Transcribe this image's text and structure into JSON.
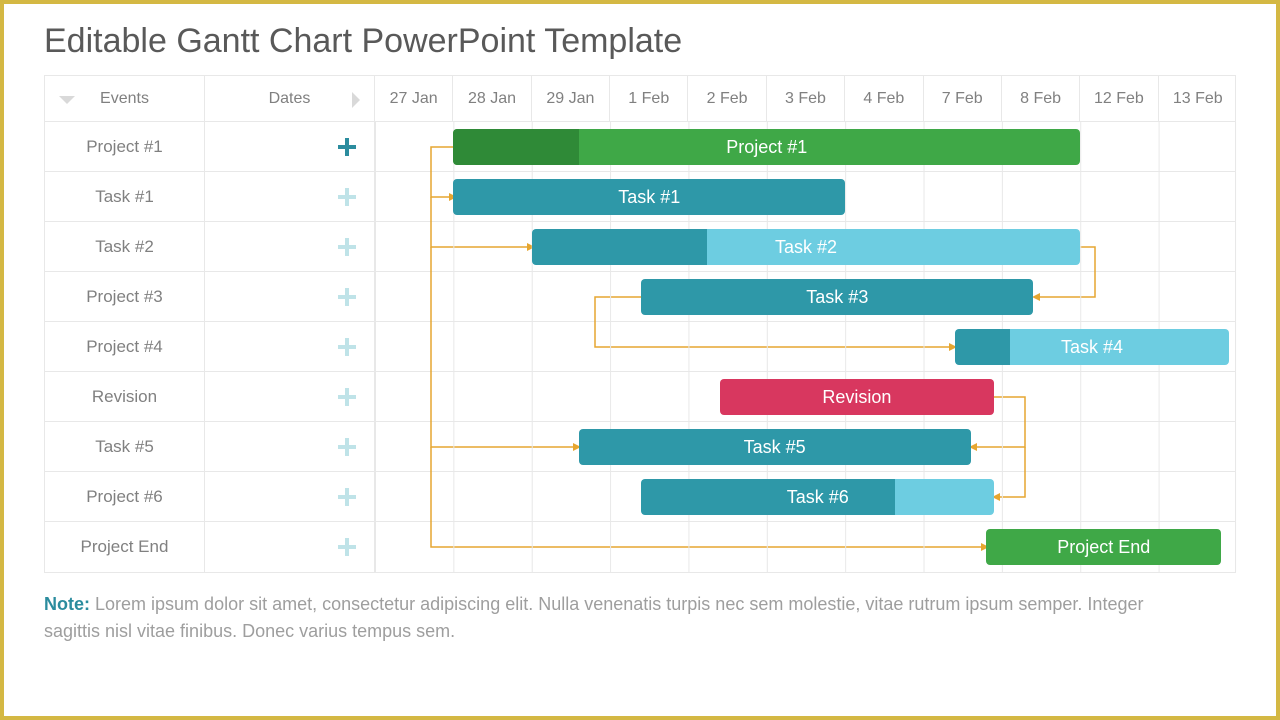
{
  "title": "Editable Gantt Chart PowerPoint Template",
  "headers": {
    "events": "Events",
    "dates": "Dates",
    "timeline": [
      "27 Jan",
      "28 Jan",
      "29 Jan",
      "1 Feb",
      "2 Feb",
      "3 Feb",
      "4 Feb",
      "7 Feb",
      "8 Feb",
      "12 Feb",
      "13 Feb"
    ]
  },
  "rows": [
    {
      "label": "Project #1",
      "plus": "dark"
    },
    {
      "label": "Task #1",
      "plus": "light"
    },
    {
      "label": "Task #2",
      "plus": "light"
    },
    {
      "label": "Project #3",
      "plus": "light"
    },
    {
      "label": "Project #4",
      "plus": "light"
    },
    {
      "label": "Revision",
      "plus": "light"
    },
    {
      "label": "Task #5",
      "plus": "light"
    },
    {
      "label": "Project #6",
      "plus": "light"
    },
    {
      "label": "Project End",
      "plus": "light"
    }
  ],
  "bars": [
    {
      "row": 0,
      "text": "Project #1",
      "start": 1,
      "span": 8,
      "bg": "#3fa847",
      "fill_bg": "#2f8a37",
      "fill_frac": 0.2
    },
    {
      "row": 1,
      "text": "Task #1",
      "start": 1,
      "span": 5,
      "bg": "#2e98a8"
    },
    {
      "row": 2,
      "text": "Task #2",
      "start": 2,
      "span": 7,
      "bg": "#6dcde1",
      "fill_bg": "#2e98a8",
      "fill_frac": 0.32
    },
    {
      "row": 3,
      "text": "Task #3",
      "start": 3.4,
      "span": 5,
      "bg": "#2e98a8"
    },
    {
      "row": 4,
      "text": "Task #4",
      "start": 7.4,
      "span": 3.5,
      "bg": "#6dcde1",
      "fill_bg": "#2e98a8",
      "fill_frac": 0.2
    },
    {
      "row": 5,
      "text": "Revision",
      "start": 4.4,
      "span": 3.5,
      "bg": "#d8375f"
    },
    {
      "row": 6,
      "text": "Task #5",
      "start": 2.6,
      "span": 5,
      "bg": "#2e98a8"
    },
    {
      "row": 7,
      "text": "Task #6",
      "start": 3.4,
      "span": 4.5,
      "bg": "#6dcde1",
      "fill_bg": "#2e98a8",
      "fill_frac": 0.72
    },
    {
      "row": 8,
      "text": "Project End",
      "start": 7.8,
      "span": 3,
      "bg": "#3fa847"
    }
  ],
  "note": {
    "label": "Note:",
    "text": "Lorem ipsum dolor sit amet, consectetur adipiscing elit. Nulla venenatis turpis nec sem molestie, vitae rutrum ipsum semper. Integer sagittis nisl vitae finibus. Donec varius tempus sem."
  },
  "colors": {
    "teal": "#2e98a8",
    "teal_light": "#6dcde1",
    "green": "#3fa847",
    "green_dark": "#2f8a37",
    "pink": "#d8375f",
    "connector": "#e6a630"
  },
  "chart_data": {
    "type": "bar",
    "subtype": "gantt",
    "title": "Editable Gantt Chart PowerPoint Template",
    "xlabel": "Dates",
    "ylabel": "Events",
    "categories": [
      "27 Jan",
      "28 Jan",
      "29 Jan",
      "1 Feb",
      "2 Feb",
      "3 Feb",
      "4 Feb",
      "7 Feb",
      "8 Feb",
      "12 Feb",
      "13 Feb"
    ],
    "series": [
      {
        "name": "Project #1",
        "start_index": 1,
        "end_index": 9,
        "start": "28 Jan",
        "end": "12 Feb",
        "color": "#3fa847",
        "progress": 0.2
      },
      {
        "name": "Task #1",
        "start_index": 1,
        "end_index": 6,
        "start": "28 Jan",
        "end": "3 Feb",
        "color": "#2e98a8"
      },
      {
        "name": "Task #2",
        "start_index": 2,
        "end_index": 9,
        "start": "29 Jan",
        "end": "12 Feb",
        "color": "#6dcde1",
        "progress": 0.32
      },
      {
        "name": "Task #3",
        "start_index": 3.4,
        "end_index": 8.4,
        "start": "1 Feb",
        "end": "8 Feb",
        "color": "#2e98a8"
      },
      {
        "name": "Task #4",
        "start_index": 7.4,
        "end_index": 10.9,
        "start": "7 Feb",
        "end": "13 Feb",
        "color": "#6dcde1",
        "progress": 0.2
      },
      {
        "name": "Revision",
        "start_index": 4.4,
        "end_index": 7.9,
        "start": "2 Feb",
        "end": "7 Feb",
        "color": "#d8375f"
      },
      {
        "name": "Task #5",
        "start_index": 2.6,
        "end_index": 7.6,
        "start": "29 Jan",
        "end": "7 Feb",
        "color": "#2e98a8"
      },
      {
        "name": "Task #6",
        "start_index": 3.4,
        "end_index": 7.9,
        "start": "1 Feb",
        "end": "7 Feb",
        "color": "#6dcde1",
        "progress": 0.72
      },
      {
        "name": "Project End",
        "start_index": 7.8,
        "end_index": 10.8,
        "start": "7 Feb",
        "end": "13 Feb",
        "color": "#3fa847"
      }
    ],
    "dependencies": [
      {
        "from": "Project #1",
        "to": "Task #1"
      },
      {
        "from": "Project #1",
        "to": "Task #2"
      },
      {
        "from": "Project #1",
        "to": "Task #5"
      },
      {
        "from": "Project #1",
        "to": "Project End"
      },
      {
        "from": "Task #3",
        "to": "Task #4"
      },
      {
        "from": "Task #2",
        "to": "Task #3",
        "type": "finish-to-finish"
      },
      {
        "from": "Revision",
        "to": "Task #5",
        "type": "finish-to-finish"
      },
      {
        "from": "Revision",
        "to": "Task #6",
        "type": "finish-to-finish"
      }
    ]
  }
}
